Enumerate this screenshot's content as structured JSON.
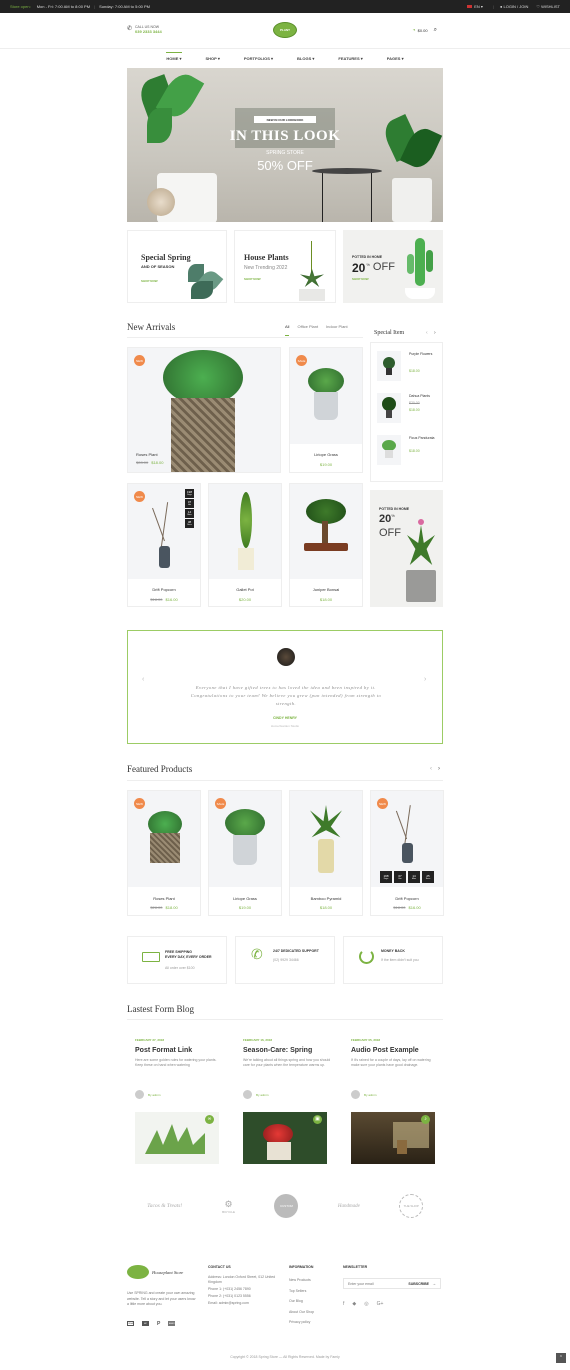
{
  "topbar": {
    "open_label": "Store open:",
    "hours_weekday": "Mon - Fri: 7:00 AM to 8:00 PM",
    "hours_weekend": "Sunday: 7:00 AM to 5:00 PM",
    "language": "EN",
    "account": "LOGIN / JOIN",
    "wishlist": "WISHLIST"
  },
  "header": {
    "call_label": "CALL US NOW",
    "phone": "039 2333 3444",
    "cart_total": "$0.00",
    "logo_text": "PLANT"
  },
  "nav": {
    "items": [
      "HOME",
      "SHOP",
      "PORTFOLIOS",
      "BLOGS",
      "FEATURES",
      "PAGES"
    ]
  },
  "hero": {
    "eyebrow": "NEW IN OUR LOOKBOOK",
    "title": "IN THIS LOOK",
    "subtitle": "SPRING STORE",
    "offer": "50% OFF"
  },
  "banners": [
    {
      "title": "Special Spring",
      "subtitle": "AND OF SEASON",
      "link": "SHOP NOW"
    },
    {
      "title": "House Plants",
      "subtitle": "New Trending 2022",
      "link": "SHOP NOW"
    },
    {
      "eyebrow": "POTTED IN HOME",
      "big": "20",
      "sup": "%",
      "off": "OFF",
      "link": "SHOP NOW"
    }
  ],
  "new_arrivals": {
    "title": "New Arrivals",
    "tabs": [
      "All",
      "Office Plant",
      "Indoor Plant"
    ],
    "products": [
      {
        "name": "Roses Plant",
        "old": "$28.00",
        "price": "$18.00",
        "badge": "NEW"
      },
      {
        "name": "Liriope Grass",
        "price": "$19.00",
        "badge": "SALE"
      },
      {
        "name": "Drift Popcorn",
        "old": "$18.00",
        "price": "$16.00",
        "badge": "NEW"
      },
      {
        "name": "Gallet Pot",
        "price": "$20.00"
      },
      {
        "name": "Juniper Bonsai",
        "price": "$18.00"
      }
    ],
    "countdown": [
      {
        "n": "198",
        "u": "Days"
      },
      {
        "n": "07",
        "u": "Hrs"
      },
      {
        "n": "14",
        "u": "Mins"
      },
      {
        "n": "38",
        "u": "Secs"
      }
    ]
  },
  "special": {
    "title": "Special Item",
    "items": [
      {
        "name": "Purple Flowers",
        "price": "$18.00"
      },
      {
        "name": "Dahua Plants",
        "old": "$20.00",
        "price": "$18.00"
      },
      {
        "name": "Ficus Pandurata",
        "price": "$18.00"
      }
    ],
    "promo": {
      "eyebrow": "POTTED IN HOME",
      "big": "20",
      "sup": "%",
      "off": "OFF"
    }
  },
  "testimonial": {
    "quote": "Everyone that I have gifted trees to has loved the idea and been inspired by it. Congratulations to your team! We believe you grew (pun intended) from strength to strength.",
    "name": "CINDY HENRY",
    "role": "Home/Garden Studio"
  },
  "featured": {
    "title": "Featured Products",
    "products": [
      {
        "name": "Roses Plant",
        "old": "$28.00",
        "price": "$18.00",
        "badge": "NEW"
      },
      {
        "name": "Liriope Grass",
        "price": "$19.00",
        "badge": "SALE"
      },
      {
        "name": "Bamboo Pyramid",
        "price": "$18.00"
      },
      {
        "name": "Drift Popcorn",
        "old": "$18.00",
        "price": "$16.00",
        "badge": "NEW"
      }
    ],
    "countdown": [
      {
        "n": "198",
        "u": "Days"
      },
      {
        "n": "07",
        "u": "Hrs"
      },
      {
        "n": "14",
        "u": "Mins"
      },
      {
        "n": "25",
        "u": "Secs"
      }
    ]
  },
  "services": [
    {
      "title": "FREE SHIPPING",
      "title2": "EVERY DAY, EVERY ORDER",
      "text": "All order over $100"
    },
    {
      "title": "24/7 DEDICATED SUPPORT",
      "text": "(02) 9929 34466"
    },
    {
      "title": "MONEY BACK",
      "text": "If the item didn't suit you"
    }
  ],
  "blog": {
    "title": "Lastest Form Blog",
    "posts": [
      {
        "date": "FEBRUARY 27, 2018",
        "title": "Post Format Link",
        "text": "Here are some golden rules for watering your plants. Keep these on hand when watering",
        "author": "By admin"
      },
      {
        "date": "FEBRUARY 16, 2018",
        "title": "Season-Care: Spring",
        "text": "We're talking about all things spring and how you should care for your plants when the temperature warms up.",
        "author": "By admin"
      },
      {
        "date": "FEBRUARY 05, 2018",
        "title": "Audio Post Example",
        "text": "If it's rained for a couple of days, lay off on watering make sure your plants have good drainage.",
        "author": "By admin"
      }
    ]
  },
  "brands": [
    "Tacos & Treats!",
    "BICYCLE",
    "CUSTOM",
    "Handmade",
    "THE SHOP"
  ],
  "footer": {
    "logo": "Houseplant Store",
    "about": "Use SPRING and create your own amazing website. Tell a story and let your users know a little more about you.",
    "contact_title": "CONTACT US",
    "contact": [
      "Address: London Oxford Street, 012 United Kingdom",
      "Phone 1: (+031) 2456 7890",
      "Phone 2: (+031) 0123 5556",
      "Email: admin@spring.com"
    ],
    "info_title": "INFORMATION",
    "info": [
      "New Products",
      "Top Sellers",
      "Our Blog",
      "About Our Shop",
      "Privacy policy"
    ],
    "news_title": "NEWSLETTER",
    "news_placeholder": "Enter your email",
    "subscribe": "SUBSCRIBE",
    "payments": [
      "VISA",
      "MC",
      "P",
      "AMEX"
    ],
    "copyright": "Copyright © 2018 Spring Store — All Rights Reserved. Made by Famiy"
  }
}
